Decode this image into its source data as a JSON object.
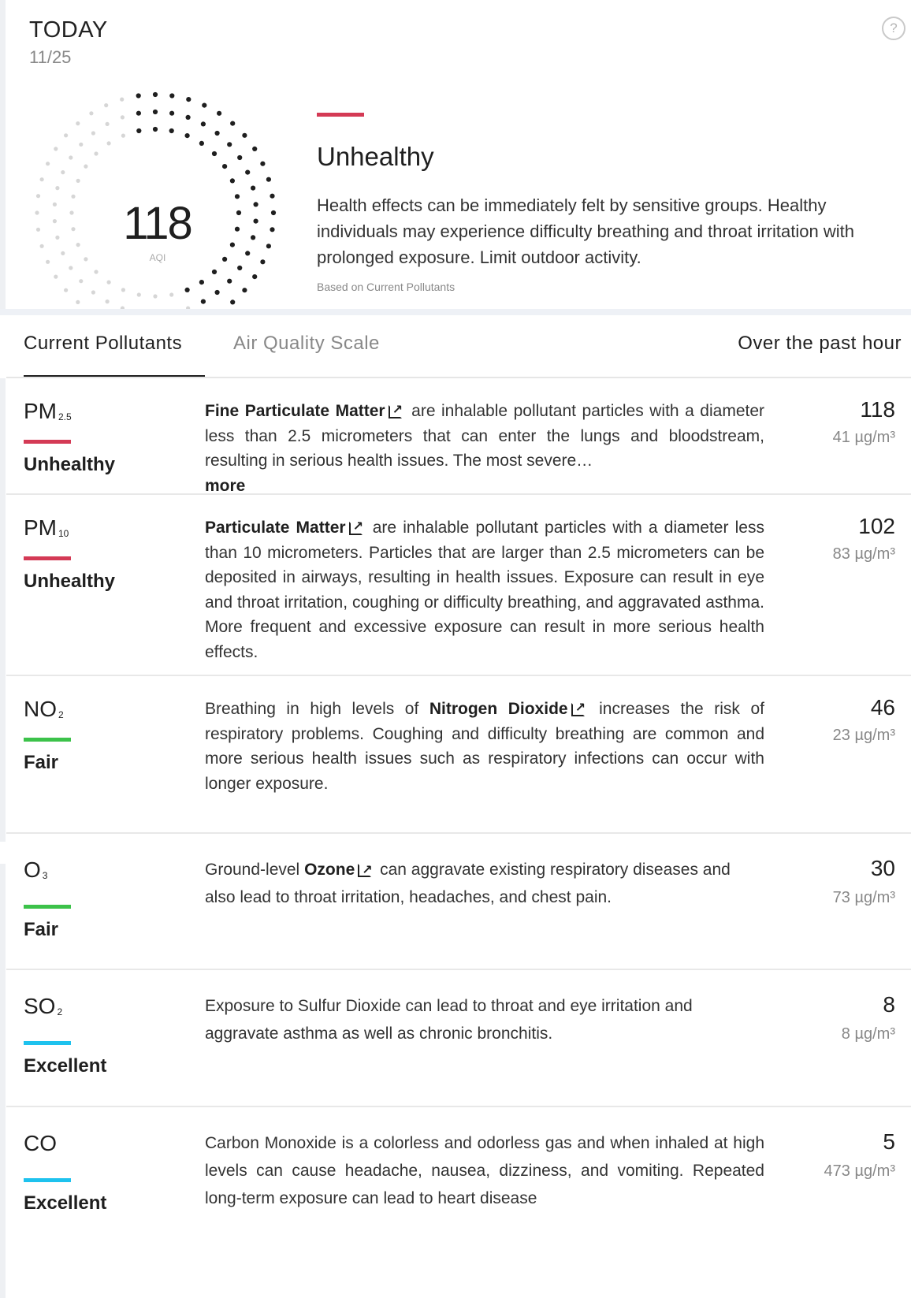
{
  "header": {
    "today_label": "TODAY",
    "date": "11/25",
    "help_glyph": "?",
    "aqi_value": "118",
    "aqi_unit": "AQI",
    "status_title": "Unhealthy",
    "status_color": "#d43a55",
    "status_description": "Health effects can be immediately felt by sensitive groups. Healthy individuals may experience difficulty breathing and throat irritation with prolonged exposure. Limit outdoor activity.",
    "status_note": "Based on Current Pollutants"
  },
  "tabs": {
    "current": "Current Pollutants",
    "scale": "Air Quality Scale",
    "past_hour": "Over the past hour"
  },
  "pollutants": [
    {
      "name_main": "PM",
      "name_sub": "2.5",
      "condition": "Unhealthy",
      "color": "#d43a55",
      "link_text": "Fine Particulate Matter",
      "desc_after": "are inhalable pollutant particles with a diameter less than 2.5 micrometers that can enter the lungs and bloodstream, resulting in serious health issues. The most severe…",
      "more_label": "more",
      "aqi": "118",
      "concentration": "41 µg/m³"
    },
    {
      "name_main": "PM",
      "name_sub": "10",
      "condition": "Unhealthy",
      "color": "#d43a55",
      "link_text": "Particulate Matter",
      "desc_after": "are inhalable pollutant particles with a diameter less than 10 micrometers. Particles that are larger than 2.5 micrometers can be deposited in airways, resulting in health issues. Exposure can result in eye and throat irritation, coughing or difficulty breathing, and aggravated asthma. More frequent and excessive exposure can result in more serious health effects.",
      "aqi": "102",
      "concentration": "83 µg/m³"
    },
    {
      "name_main": "NO",
      "name_sub": "2",
      "condition": "Fair",
      "color": "#3cc24a",
      "desc_before": "Breathing in high levels of",
      "link_text": "Nitrogen Dioxide",
      "desc_after": "increases the risk of respiratory problems. Coughing and difficulty breathing are common and more serious health issues such as respiratory infections can occur with longer exposure.",
      "aqi": "46",
      "concentration": "23 µg/m³"
    },
    {
      "name_main": "O",
      "name_sub": "3",
      "condition": "Fair",
      "color": "#3cc24a",
      "desc_before": "Ground-level",
      "link_text": "Ozone",
      "desc_after": "can aggravate existing respiratory diseases and also lead to throat irritation, headaches, and chest pain.",
      "aqi": "30",
      "concentration": "73 µg/m³"
    },
    {
      "name_main": "SO",
      "name_sub": "2",
      "condition": "Excellent",
      "color": "#1ec2ee",
      "desc_before": "Exposure to Sulfur Dioxide can lead to throat and eye irritation and aggravate asthma as well as chronic bronchitis.",
      "aqi": "8",
      "concentration": "8 µg/m³"
    },
    {
      "name_main": "CO",
      "condition": "Excellent",
      "color": "#1ec2ee",
      "desc_before": "Carbon Monoxide is a colorless and odorless gas and when inhaled at high levels can cause headache, nausea, dizziness, and vomiting. Repeated long-term exposure can lead to heart disease",
      "aqi": "5",
      "concentration": "473 µg/m³"
    }
  ]
}
